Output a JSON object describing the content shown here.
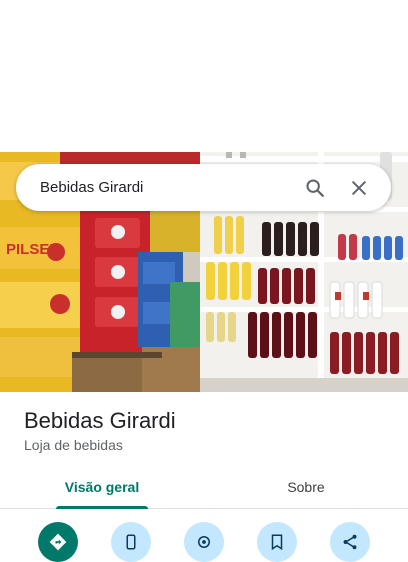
{
  "search": {
    "query": "Bebidas Girardi",
    "search_icon": "search-icon",
    "close_icon": "close-icon"
  },
  "place": {
    "name": "Bebidas Girardi",
    "category": "Loja de bebidas",
    "photo": "store-interior-photo"
  },
  "tabs": [
    {
      "label": "Visão geral",
      "active": true
    },
    {
      "label": "Sobre",
      "active": false
    }
  ],
  "actions": [
    {
      "icon": "directions-icon",
      "color": "#00796b"
    },
    {
      "icon": "phone-icon",
      "color": "#c2e7ff"
    },
    {
      "icon": "navigation-icon",
      "color": "#c2e7ff"
    },
    {
      "icon": "save-icon",
      "color": "#c2e7ff"
    },
    {
      "icon": "share-icon",
      "color": "#c2e7ff"
    }
  ],
  "colors": {
    "accent": "#00796b",
    "action_bg": "#c2e7ff"
  }
}
